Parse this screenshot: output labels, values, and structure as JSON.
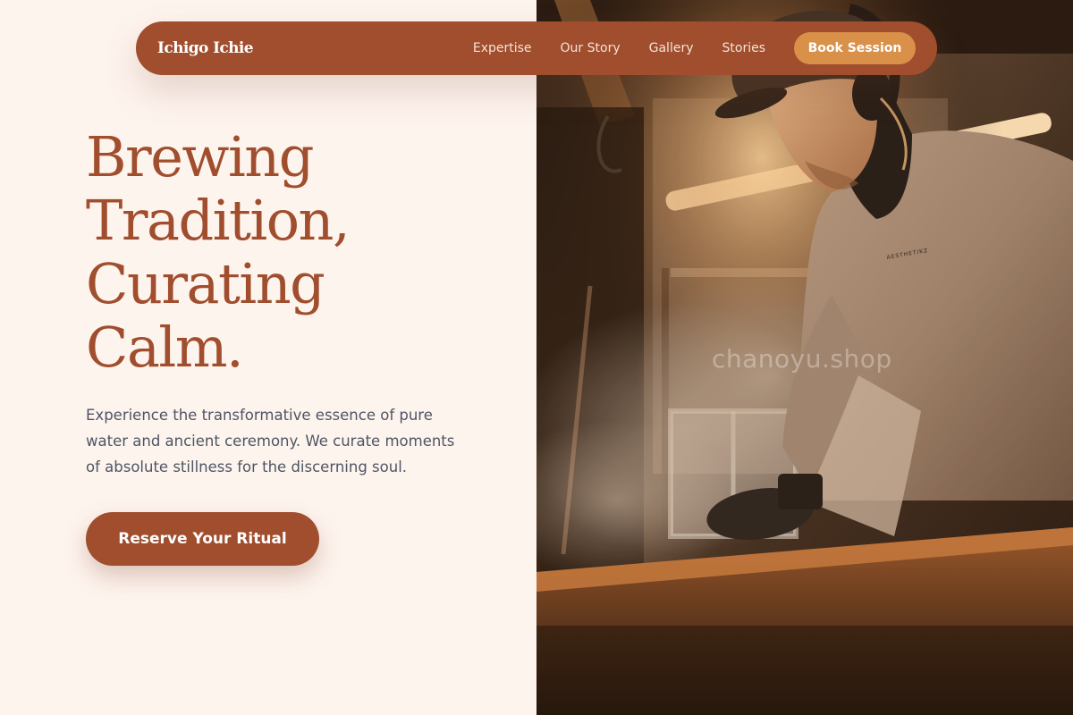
{
  "brand": {
    "name": "Ichigo Ichie"
  },
  "nav": {
    "links": [
      "Expertise",
      "Our Story",
      "Gallery",
      "Stories"
    ],
    "book_label": "Book Session"
  },
  "hero": {
    "title_lines": [
      "Brewing",
      "Tradition,",
      "Curating",
      "Calm."
    ],
    "subtitle": "Experience the transformative essence of pure water and ancient ceremony. We curate moments of absolute stillness for the discerning soul.",
    "cta_label": "Reserve Your Ritual"
  },
  "photo": {
    "watermark": "chanoyu.shop",
    "sweatshirt_text": "AESTHETIKZ"
  },
  "colors": {
    "background": "#FEF4EE",
    "primary": "#A04E2E",
    "accent": "#D99048",
    "body_text": "#4E5563"
  }
}
